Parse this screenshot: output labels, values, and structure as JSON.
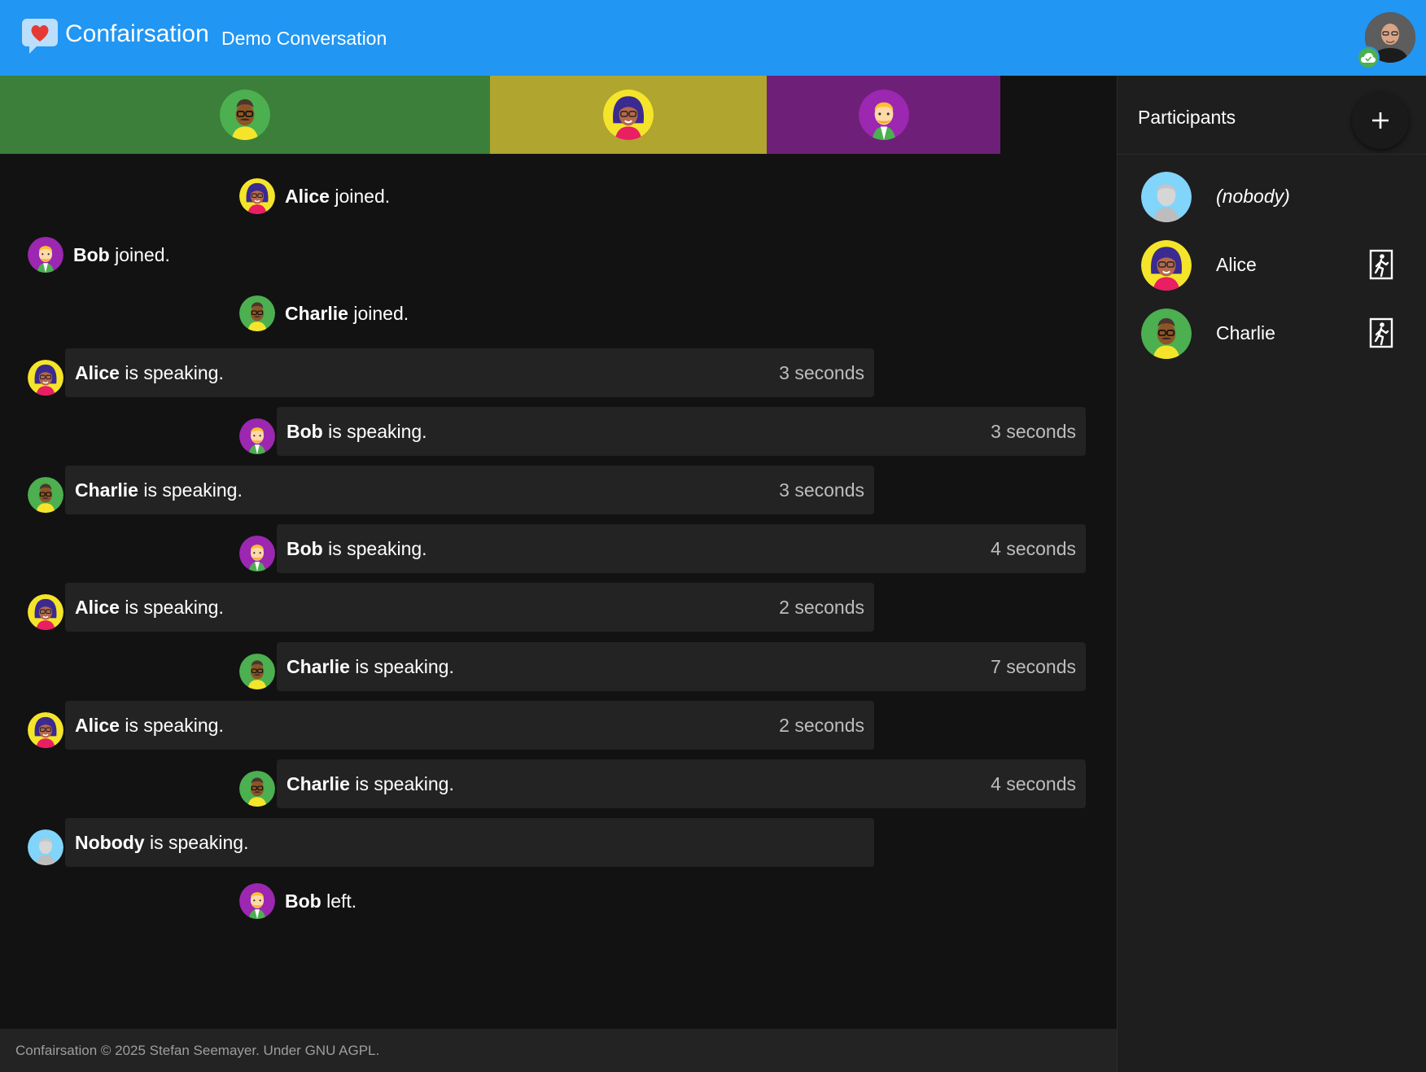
{
  "app": {
    "title": "Confairsation",
    "conversation_title": "Demo Conversation",
    "brand_color": "#2196f3",
    "online_status_icon": "cloud-check-icon"
  },
  "speaker_bar": [
    {
      "name": "Charlie",
      "color": "#3b7f3a",
      "share": 0.4388
    },
    {
      "name": "Alice",
      "color": "#b0a52e",
      "share": 0.2478
    },
    {
      "name": "Bob",
      "color": "#6e2079",
      "share": 0.2092
    }
  ],
  "feed": {
    "joined_suffix": " joined.",
    "speaking_suffix": " is speaking.",
    "left_suffix": " left.",
    "events": [
      {
        "type": "joined",
        "who": "Alice"
      },
      {
        "type": "joined",
        "who": "Bob"
      },
      {
        "type": "joined",
        "who": "Charlie"
      },
      {
        "type": "speaking",
        "who": "Alice",
        "duration": "3 seconds"
      },
      {
        "type": "speaking",
        "who": "Bob",
        "duration": "3 seconds"
      },
      {
        "type": "speaking",
        "who": "Charlie",
        "duration": "3 seconds"
      },
      {
        "type": "speaking",
        "who": "Bob",
        "duration": "4 seconds"
      },
      {
        "type": "speaking",
        "who": "Alice",
        "duration": "2 seconds"
      },
      {
        "type": "speaking",
        "who": "Charlie",
        "duration": "7 seconds"
      },
      {
        "type": "speaking",
        "who": "Alice",
        "duration": "2 seconds"
      },
      {
        "type": "speaking",
        "who": "Charlie",
        "duration": "4 seconds"
      },
      {
        "type": "speaking",
        "who": "Nobody",
        "duration": ""
      },
      {
        "type": "left",
        "who": "Bob"
      }
    ]
  },
  "participants": {
    "title": "Participants",
    "add_icon": "plus-icon",
    "leave_icon": "door-exit-icon",
    "items": [
      {
        "name": "(nobody)",
        "italic": true,
        "can_leave": false
      },
      {
        "name": "Alice",
        "italic": false,
        "can_leave": true
      },
      {
        "name": "Charlie",
        "italic": false,
        "can_leave": true
      }
    ]
  },
  "footer": {
    "text": "Confairsation © 2025 Stefan Seemayer. Under GNU AGPL."
  }
}
